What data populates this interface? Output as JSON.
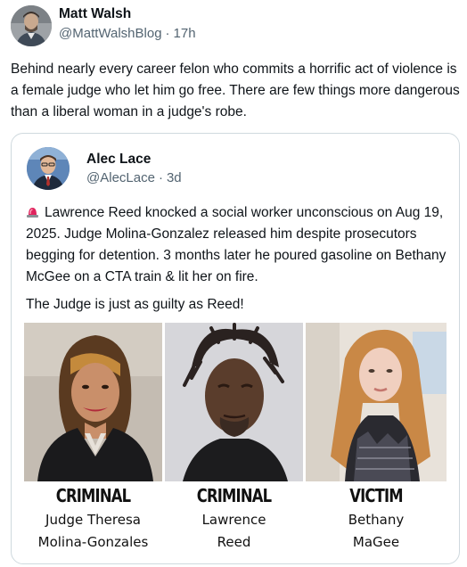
{
  "author": {
    "name": "Matt Walsh",
    "handle": "@MattWalshBlog",
    "separator": "·",
    "time": "17h"
  },
  "post_text": "Behind nearly every career felon who commits a horrific act of violence is a female judge who let him go free. There are few things more dangerous than a liberal woman in a judge's robe.",
  "quoted": {
    "name": "Alec Lace",
    "handle": "@AlecLace",
    "separator": "·",
    "time": "3d",
    "icon": "police-light-icon",
    "text": "Lawrence Reed knocked a social worker unconscious on Aug 19, 2025. Judge Molina-Gonzalez released him despite prosecutors begging for detention. 3 months later he poured gasoline on Bethany McGee on a CTA train & lit her on fire.",
    "text2": "The Judge is just as guilty as Reed!",
    "media": {
      "panels": [
        {
          "title": "CRIMINAL",
          "line1": "Judge Theresa",
          "line2": "Molina-Gonzales"
        },
        {
          "title": "CRIMINAL",
          "line1": "Lawrence",
          "line2": "Reed"
        },
        {
          "title": "VICTIM",
          "line1": "Bethany",
          "line2": "MaGee"
        }
      ]
    }
  },
  "colors": {
    "text": "#0f1419",
    "secondary": "#536471",
    "border": "#cfd9de",
    "siren": "#e0245e"
  }
}
